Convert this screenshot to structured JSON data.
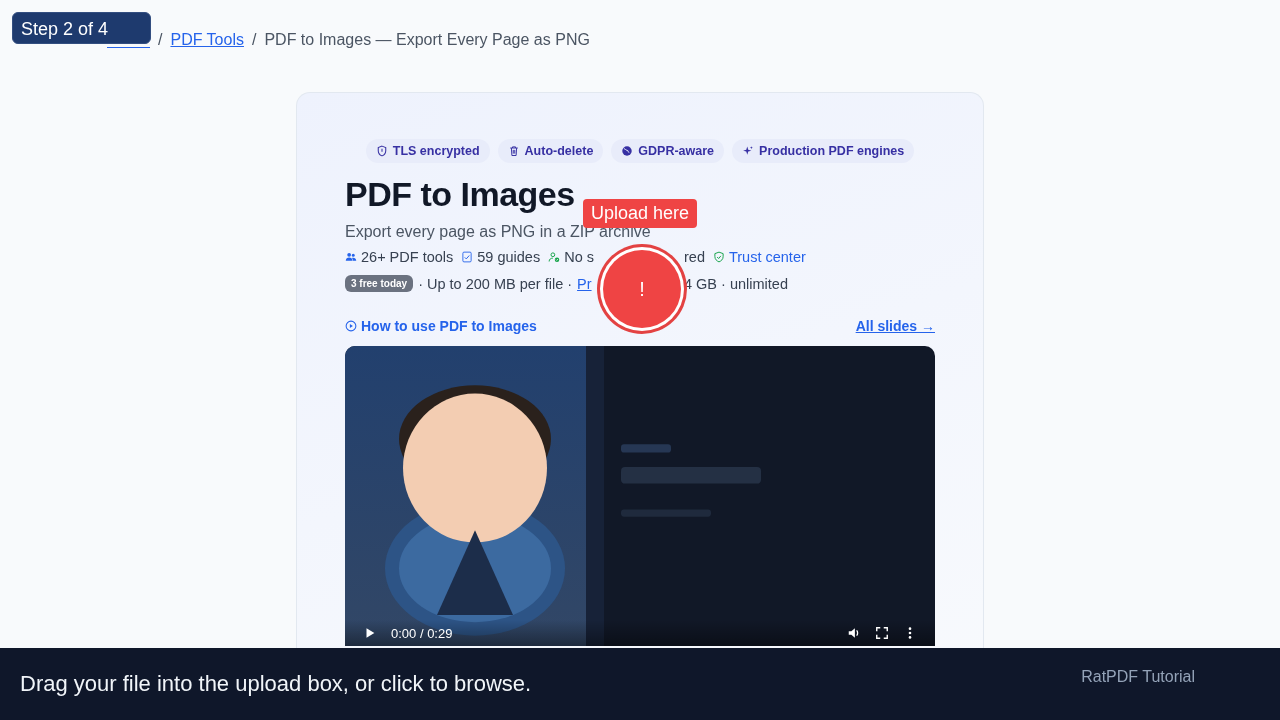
{
  "tutorial": {
    "step": "Step 2 of 4",
    "callout": "Upload here",
    "marker": "!",
    "caption": "Drag your file into the upload box, or click to browse.",
    "brand": "RatPDF Tutorial"
  },
  "breadcrumb": [
    {
      "kind": "separator",
      "label": "/"
    },
    {
      "kind": "link",
      "label": "PDF Tools"
    },
    {
      "kind": "separator",
      "label": "/"
    },
    {
      "kind": "current",
      "label": "PDF to Images — Export Every Page as PNG"
    }
  ],
  "badges": [
    {
      "label": "TLS encrypted"
    },
    {
      "label": "Auto-delete"
    },
    {
      "label": "GDPR-aware"
    },
    {
      "label": "Production PDF engines"
    }
  ],
  "title": "PDF to Images",
  "subtitle": "Export every page as PNG in a ZIP archive",
  "stats": [
    {
      "kind": "text",
      "parts": [
        "26+ PDF tools"
      ]
    },
    {
      "kind": "text",
      "parts": [
        "59 guides"
      ]
    },
    {
      "kind": "text",
      "parts": [
        "No s",
        "red"
      ]
    },
    {
      "kind": "link",
      "parts": [
        "Trust center"
      ]
    }
  ],
  "limits": {
    "pill": "3 free today",
    "pieces": [
      {
        "kind": "text",
        "text": "· Up to 200 MB per file ·"
      },
      {
        "kind": "link",
        "text": "Pr"
      },
      {
        "kind": "text",
        "text": "4 GB · unlimited"
      }
    ]
  },
  "video_header": {
    "title": "How to use PDF to Images",
    "link": "All slides →"
  },
  "video": {
    "kind": "picture",
    "time": "0:00 / 0:29"
  }
}
